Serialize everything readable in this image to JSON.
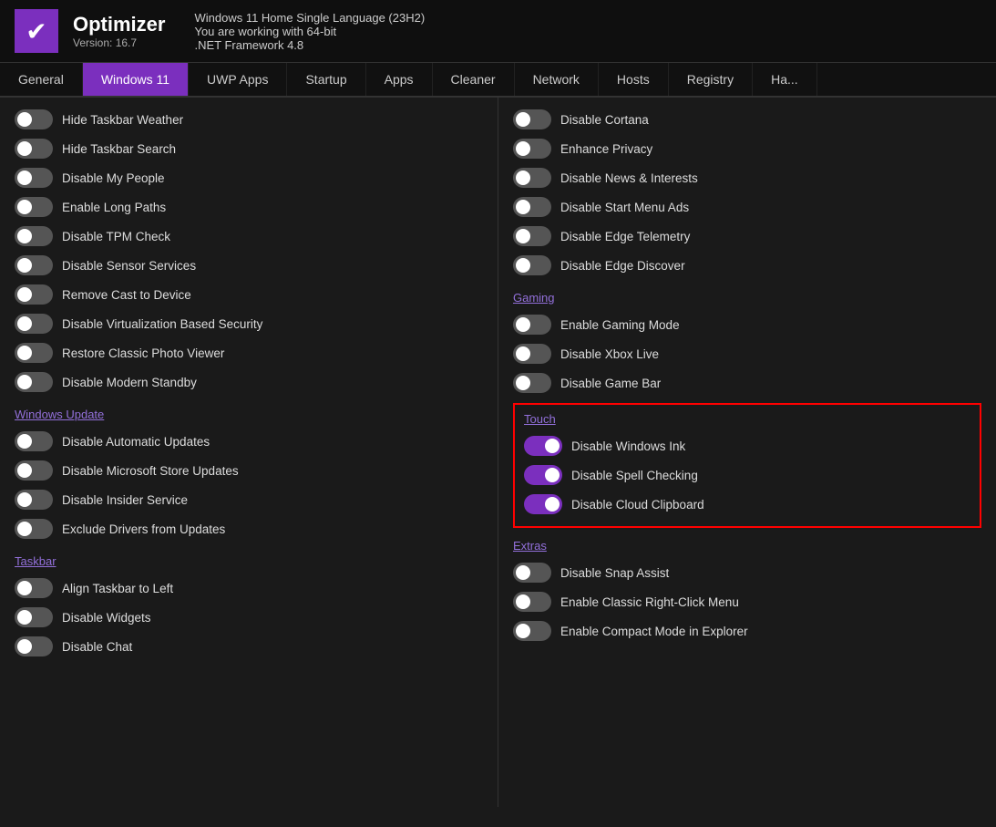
{
  "app": {
    "name": "Optimizer",
    "version_label": "Version: 16.7",
    "os_info": "Windows 11 Home Single Language (23H2)",
    "bit_info": "You are working with 64-bit",
    "framework": ".NET Framework 4.8",
    "logo_symbol": "✔"
  },
  "nav": {
    "tabs": [
      {
        "id": "general",
        "label": "General",
        "active": false
      },
      {
        "id": "windows11",
        "label": "Windows 11",
        "active": true
      },
      {
        "id": "uwp_apps",
        "label": "UWP Apps",
        "active": false
      },
      {
        "id": "startup",
        "label": "Startup",
        "active": false
      },
      {
        "id": "apps",
        "label": "Apps",
        "active": false
      },
      {
        "id": "cleaner",
        "label": "Cleaner",
        "active": false
      },
      {
        "id": "network",
        "label": "Network",
        "active": false
      },
      {
        "id": "hosts",
        "label": "Hosts",
        "active": false
      },
      {
        "id": "registry",
        "label": "Registry",
        "active": false
      },
      {
        "id": "ha",
        "label": "Ha...",
        "active": false
      }
    ]
  },
  "left_col": {
    "items": [
      {
        "label": "Hide Taskbar Weather",
        "state": "off"
      },
      {
        "label": "Hide Taskbar Search",
        "state": "off"
      },
      {
        "label": "Disable My People",
        "state": "off"
      },
      {
        "label": "Enable Long Paths",
        "state": "off"
      },
      {
        "label": "Disable TPM Check",
        "state": "off"
      },
      {
        "label": "Disable Sensor Services",
        "state": "off"
      },
      {
        "label": "Remove Cast to Device",
        "state": "off"
      },
      {
        "label": "Disable Virtualization Based Security",
        "state": "off"
      },
      {
        "label": "Restore Classic Photo Viewer",
        "state": "off"
      },
      {
        "label": "Disable Modern Standby",
        "state": "off"
      }
    ],
    "sections": [
      {
        "label": "Windows Update",
        "items": [
          {
            "label": "Disable Automatic Updates",
            "state": "off"
          },
          {
            "label": "Disable Microsoft Store Updates",
            "state": "off"
          },
          {
            "label": "Disable Insider Service",
            "state": "off"
          },
          {
            "label": "Exclude Drivers from Updates",
            "state": "off"
          }
        ]
      },
      {
        "label": "Taskbar",
        "items": [
          {
            "label": "Align Taskbar to Left",
            "state": "off"
          },
          {
            "label": "Disable Widgets",
            "state": "off"
          },
          {
            "label": "Disable Chat",
            "state": "off"
          }
        ]
      }
    ]
  },
  "right_col": {
    "items": [
      {
        "label": "Disable Cortana",
        "state": "off"
      },
      {
        "label": "Enhance Privacy",
        "state": "off"
      },
      {
        "label": "Disable News & Interests",
        "state": "off"
      },
      {
        "label": "Disable Start Menu Ads",
        "state": "off"
      },
      {
        "label": "Disable Edge Telemetry",
        "state": "off"
      },
      {
        "label": "Disable Edge Discover",
        "state": "off"
      }
    ],
    "sections": [
      {
        "label": "Gaming",
        "items": [
          {
            "label": "Enable Gaming Mode",
            "state": "off"
          },
          {
            "label": "Disable Xbox Live",
            "state": "off"
          },
          {
            "label": "Disable Game Bar",
            "state": "off"
          }
        ]
      },
      {
        "label": "Touch",
        "highlighted": true,
        "items": [
          {
            "label": "Disable Windows Ink",
            "state": "on"
          },
          {
            "label": "Disable Spell Checking",
            "state": "on"
          },
          {
            "label": "Disable Cloud Clipboard",
            "state": "on"
          }
        ]
      },
      {
        "label": "Extras",
        "items": [
          {
            "label": "Disable Snap Assist",
            "state": "off"
          },
          {
            "label": "Enable Classic Right-Click Menu",
            "state": "off"
          },
          {
            "label": "Enable Compact Mode in Explorer",
            "state": "off"
          }
        ]
      }
    ]
  }
}
